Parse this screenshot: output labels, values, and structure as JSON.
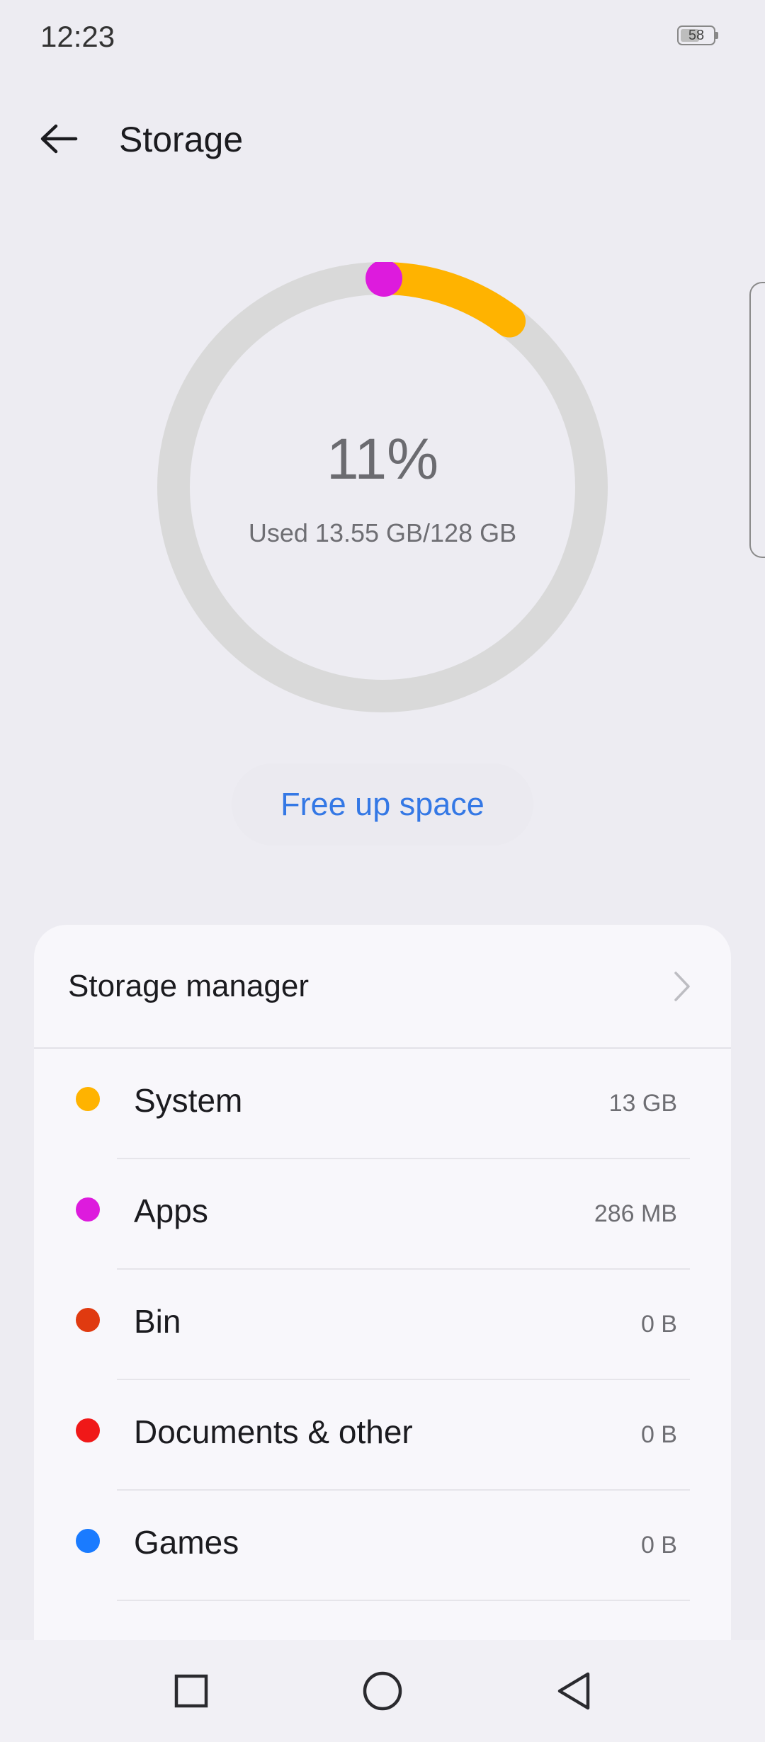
{
  "status_bar": {
    "time": "12:23",
    "battery_level": "58",
    "battery_fraction": 0.58
  },
  "header": {
    "back_icon": "arrow-left-icon",
    "title": "Storage"
  },
  "usage": {
    "percent_label": "11%",
    "used_label": "Used 13.55 GB/128 GB",
    "segments": [
      {
        "name": "Apps",
        "fraction": 0.0022,
        "color": "#DD1BDD"
      },
      {
        "name": "System",
        "fraction": 0.1016,
        "color": "#FFB300"
      }
    ],
    "track_color": "#D9D9D9"
  },
  "free_button": {
    "label": "Free up space"
  },
  "storage_manager": {
    "label": "Storage manager",
    "chevron_icon": "chevron-right-icon"
  },
  "categories": [
    {
      "label": "System",
      "value": "13 GB",
      "color": "#FFB300"
    },
    {
      "label": "Apps",
      "value": "286 MB",
      "color": "#DD1BDD"
    },
    {
      "label": "Bin",
      "value": "0 B",
      "color": "#E03A10"
    },
    {
      "label": "Documents & other",
      "value": "0 B",
      "color": "#F01818"
    },
    {
      "label": "Games",
      "value": "0 B",
      "color": "#1A7BFF"
    }
  ],
  "nav": {
    "recents_icon": "square-icon",
    "home_icon": "circle-icon",
    "back_icon": "triangle-back-icon"
  }
}
